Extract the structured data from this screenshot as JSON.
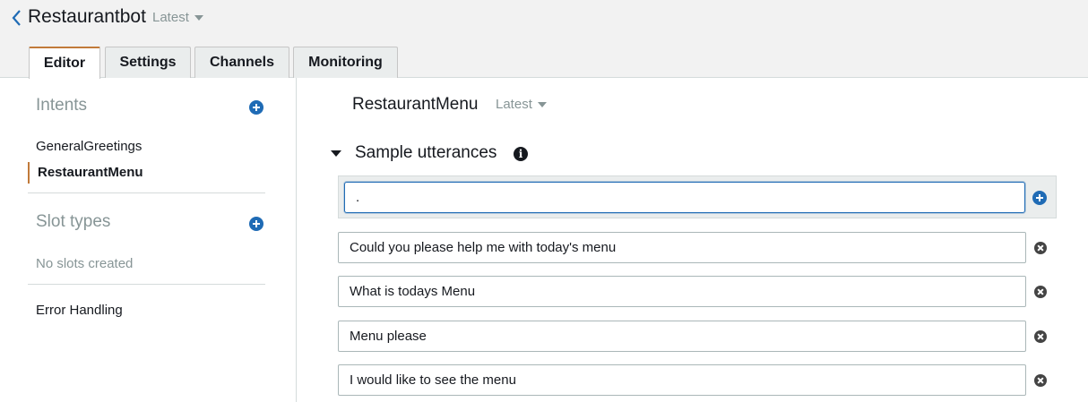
{
  "header": {
    "bot_name": "Restaurantbot",
    "version": "Latest"
  },
  "tabs": [
    {
      "label": "Editor",
      "active": true
    },
    {
      "label": "Settings",
      "active": false
    },
    {
      "label": "Channels",
      "active": false
    },
    {
      "label": "Monitoring",
      "active": false
    }
  ],
  "sidebar": {
    "intents_heading": "Intents",
    "intents": [
      {
        "label": "GeneralGreetings",
        "selected": false
      },
      {
        "label": "RestaurantMenu",
        "selected": true
      }
    ],
    "slot_types_heading": "Slot types",
    "no_slots_text": "No slots created",
    "error_handling_label": "Error Handling"
  },
  "main": {
    "intent_name": "RestaurantMenu",
    "intent_version": "Latest",
    "section_title": "Sample utterances",
    "new_utterance_value": ".",
    "utterances": [
      "Could you please help me with today's menu",
      "What is todays Menu",
      "Menu please",
      "I would like to see the menu"
    ]
  },
  "colors": {
    "accent_tab": "#c17a3a",
    "primary_blue": "#1f6bb5",
    "muted_text": "#879596",
    "header_bg": "#f2f2f2"
  },
  "icons": [
    "chevron-left-icon",
    "caret-down-icon",
    "add-circle-icon",
    "info-icon",
    "remove-circle-icon"
  ]
}
